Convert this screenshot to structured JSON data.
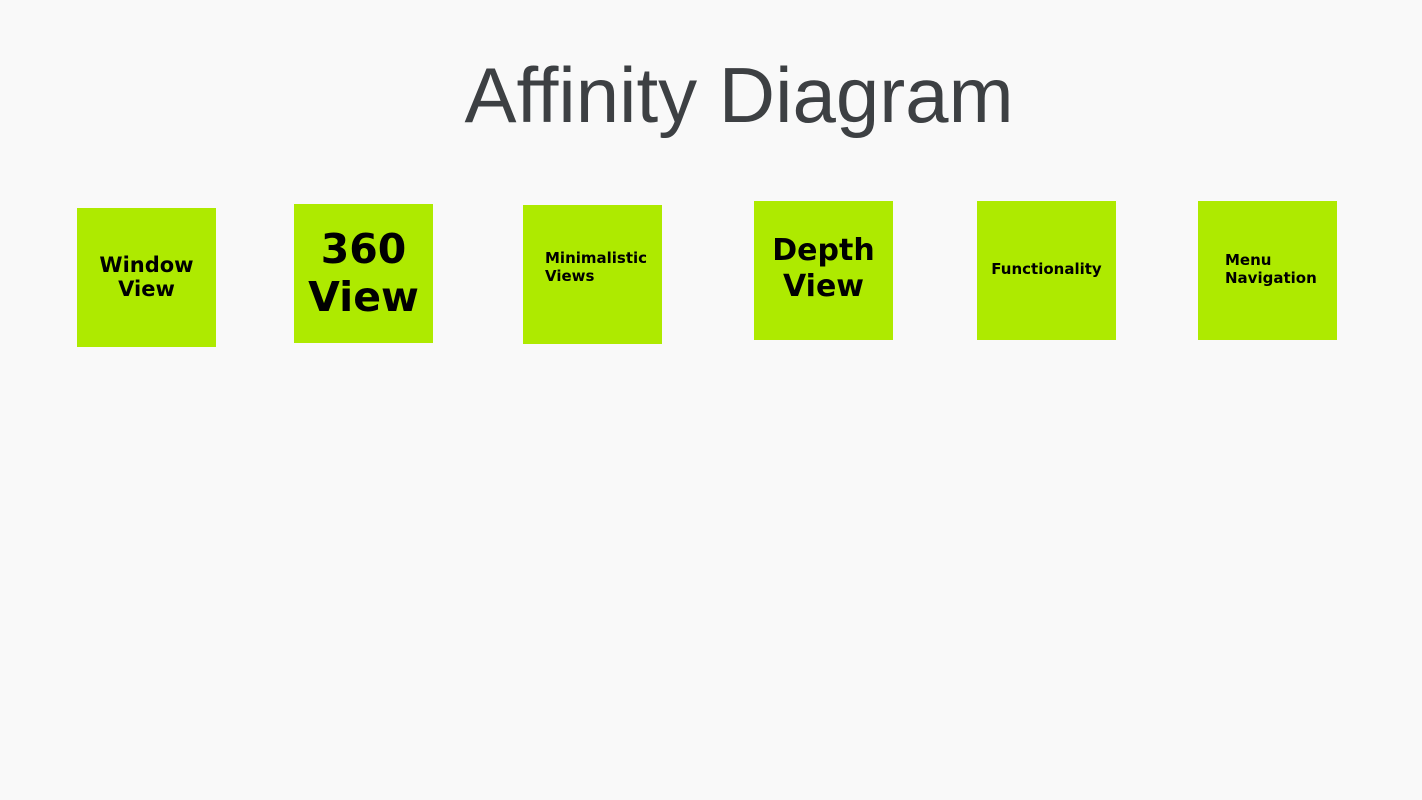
{
  "title": "Affinity Diagram",
  "colors": {
    "background": "#f9f9f9",
    "note": "#aeea00",
    "title_text": "#3d4043",
    "note_text": "#000000"
  },
  "notes": [
    {
      "label": "Window View"
    },
    {
      "label": "360 View"
    },
    {
      "label": "Minimalistic Views"
    },
    {
      "label": "Depth View"
    },
    {
      "label": "Functionality"
    },
    {
      "label": "Menu Navigation"
    }
  ]
}
